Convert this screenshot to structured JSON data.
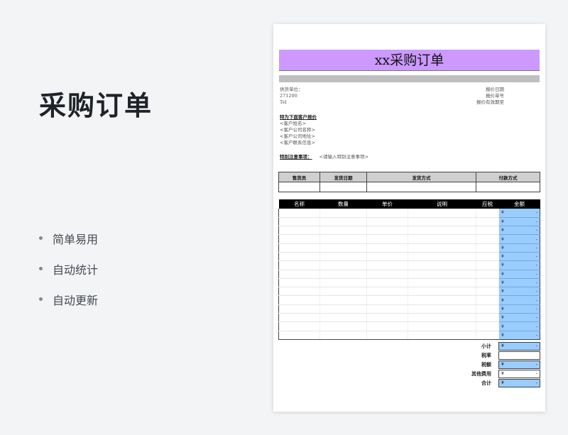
{
  "promo": {
    "title": "采购订单",
    "features": [
      "简单易用",
      "自动统计",
      "自动更新"
    ]
  },
  "doc": {
    "title": "xx采购订单",
    "supplier": {
      "unit": "供货单位：",
      "code": "271200",
      "tel": "Tel"
    },
    "quote": {
      "date": "报价日期",
      "number": "报价单号",
      "valid": "报价有效期至"
    },
    "customer": {
      "heading": "特为下面客户报价",
      "lines": [
        "<客户姓名>",
        "<客户公司名称>",
        "<客户公司地址>",
        "<客户联系信息>"
      ]
    },
    "note": {
      "label": "特别注意事项：",
      "placeholder": "<请输入特别注意事项>"
    },
    "shipping_headers": [
      "售货员",
      "发货日期",
      "发货方式",
      "付款方式"
    ],
    "item_headers": [
      "名称",
      "数量",
      "单价",
      "说明",
      "应税",
      "金额"
    ],
    "currency": "¥",
    "dash": "-",
    "item_amounts": [
      "-",
      "-",
      "-",
      "-",
      "-",
      "-",
      "-",
      "-",
      "-",
      "-",
      "-",
      "-",
      "-",
      "-",
      "-"
    ],
    "totals": {
      "subtotal": "小计",
      "tax_rate": "税率",
      "tax_amount": "税额",
      "other": "其他费用",
      "total": "合计"
    }
  },
  "colors": {
    "title_bg": "#cc99ff",
    "amount_bg": "#99ccff",
    "header_bg": "#000000"
  }
}
